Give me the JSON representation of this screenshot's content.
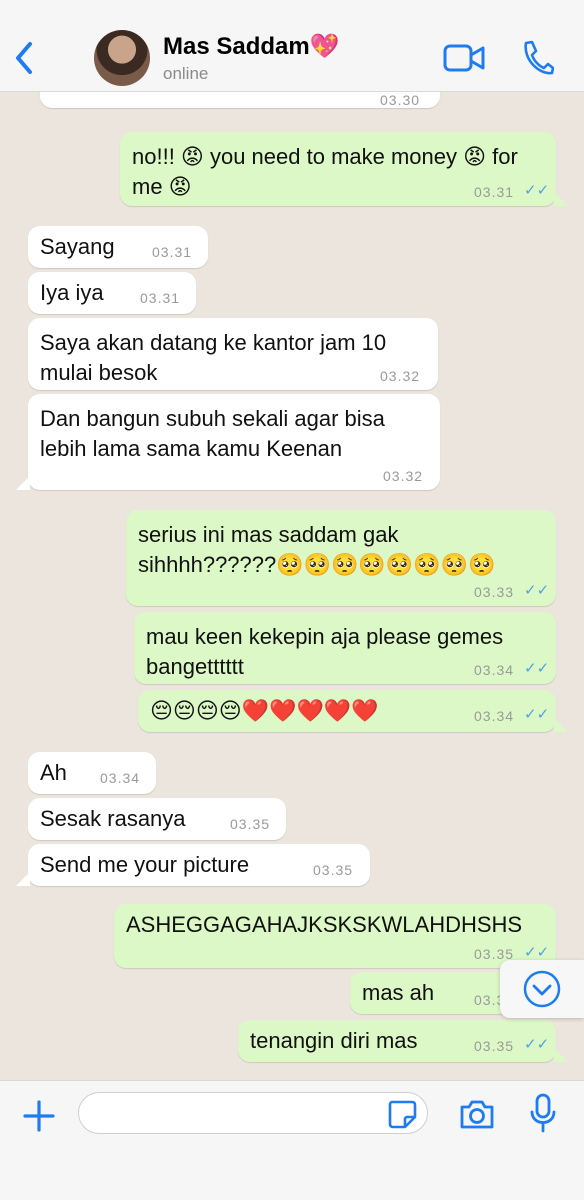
{
  "header": {
    "contact_name": "Mas Saddam💖",
    "status": "online"
  },
  "messages": [
    {
      "dir": "out",
      "text": "",
      "time": "03.30"
    },
    {
      "dir": "out",
      "text": "no!!! 😡 you need to make money 😡 for me 😡",
      "time": "03.31"
    },
    {
      "dir": "in",
      "text": "Sayang",
      "time": "03.31"
    },
    {
      "dir": "in",
      "text": "Iya iya",
      "time": "03.31"
    },
    {
      "dir": "in",
      "text": "Saya akan datang ke kantor jam 10 mulai besok",
      "time": "03.32"
    },
    {
      "dir": "in",
      "text": "Dan bangun subuh sekali agar bisa lebih lama sama kamu Keenan",
      "time": "03.32"
    },
    {
      "dir": "out",
      "text": "serius ini mas saddam gak sihhhh??????🥺🥺🥺🥺🥺🥺🥺🥺",
      "time": "03.33"
    },
    {
      "dir": "out",
      "text": "mau keen kekepin aja please gemes bangetttttt",
      "time": "03.34"
    },
    {
      "dir": "out",
      "text": "😔😔😔😔❤️❤️❤️❤️❤️",
      "time": "03.34"
    },
    {
      "dir": "in",
      "text": "Ah",
      "time": "03.34"
    },
    {
      "dir": "in",
      "text": "Sesak rasanya",
      "time": "03.35"
    },
    {
      "dir": "in",
      "text": "Send me your picture",
      "time": "03.35"
    },
    {
      "dir": "out",
      "text": "ASHEGGAGAHAJKSKSKWLAHDHSHS",
      "time": "03.35"
    },
    {
      "dir": "out",
      "text": "mas ah",
      "time": "03.35"
    },
    {
      "dir": "out",
      "text": "tenangin diri mas",
      "time": "03.35"
    }
  ],
  "composer": {
    "placeholder": ""
  }
}
